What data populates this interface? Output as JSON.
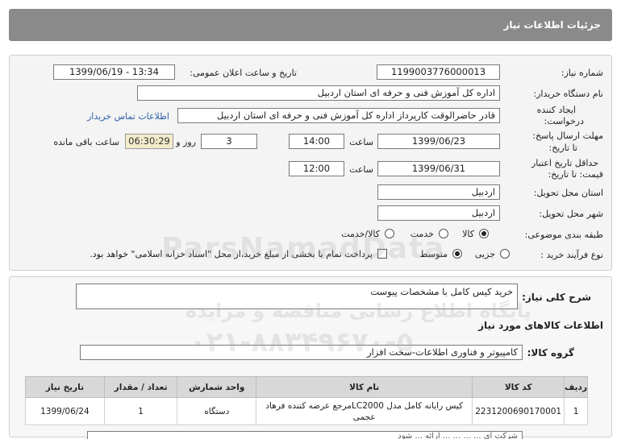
{
  "header": {
    "title": "جزئیات اطلاعات نیاز"
  },
  "form": {
    "need_number_label": "شماره نیاز:",
    "need_number": "1199003776000013",
    "announce_label": "تاریخ و ساعت اعلان عمومی:",
    "announce_value": "1399/06/19 - 13:34",
    "buyer_label": "نام دستگاه خریدار:",
    "buyer_value": "اداره کل آموزش فنی و حرفه ای استان اردبیل",
    "creator_label_1": "ایجاد کننده",
    "creator_label_2": "درخواست:",
    "creator_value": "قادر حاضرالوقت کارپرداز اداره کل آموزش فنی و حرفه ای استان اردبیل",
    "contact_link": "اطلاعات تماس خریدار",
    "deadline_label_1": "مهلت ارسال پاسخ:",
    "deadline_label_2": "تا تاریخ:",
    "deadline_date": "1399/06/23",
    "time_label": "ساعت",
    "deadline_time": "14:00",
    "days_value": "3",
    "days_label": "روز و",
    "remaining_time": "06:30:29",
    "remaining_label": "ساعت باقی مانده",
    "validity_label_1": "حداقل تاریخ اعتبار",
    "validity_label_2": "قیمت: تا تاریخ:",
    "validity_date": "1399/06/31",
    "validity_time": "12:00",
    "province_label": "استان محل تحویل:",
    "province_value": "اردبیل",
    "city_label": "شهر محل تحویل:",
    "city_value": "اردبیل",
    "category_label": "طبقه بندی موضوعی:",
    "category_options": [
      "کالا",
      "خدمت",
      "کالا/خدمت"
    ],
    "process_label": "نوع فرآیند خرید :",
    "process_options": [
      "جزیی",
      "متوسط"
    ],
    "payment_note": "پرداخت تمام یا بخشی از مبلغ خرید،از محل \"اسناد خزانه اسلامی\" خواهد بود."
  },
  "summary": {
    "label": "شرح کلی نیاز:",
    "value": "خرید کیس کامل با مشخصات پیوست"
  },
  "goods_info": {
    "title": "اطلاعات کالاهای مورد نیاز",
    "group_label": "گروه کالا:",
    "group_value": "کامپیوتر و فناوری اطلاعات-سخت افزار"
  },
  "table": {
    "headers": [
      "ردیف",
      "کد کالا",
      "نام کالا",
      "واحد شمارش",
      "تعداد / مقدار",
      "تاریخ نیاز"
    ],
    "rows": [
      [
        "1",
        "2231200690170001",
        "کیس رایانه کامل مدل LC2000مرجع عرضه کننده فرهاد عجمی",
        "دستگاه",
        "1",
        "1399/06/24"
      ]
    ]
  },
  "footer_partial": "شرکت ای ... ... ... ... ارائه ... شود",
  "watermark": {
    "brand": "ParsNamadData",
    "line1": "پایگاه اطلاع رسانی مناقصه و مزایده",
    "phone": "۰۲۱-۸۸۳۴۹۶۷۰-۵"
  }
}
